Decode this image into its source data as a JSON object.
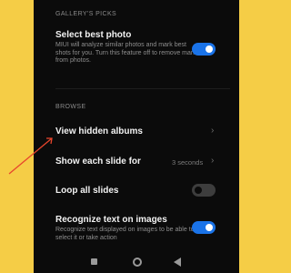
{
  "gallery_picks": {
    "header": "GALLERY'S PICKS",
    "select_best_photo": {
      "title": "Select best photo",
      "description": "MIUI will analyze similar photos and mark best shots for you. Turn this feature off to remove marks from photos.",
      "enabled": true
    }
  },
  "browse": {
    "header": "BROWSE",
    "view_hidden_albums": {
      "title": "View hidden albums"
    },
    "show_each_slide_for": {
      "title": "Show each slide for",
      "value": "3 seconds"
    },
    "loop_all_slides": {
      "title": "Loop all slides",
      "enabled": false
    },
    "recognize_text": {
      "title": "Recognize text on images",
      "description": "Recognize text displayed on images to be able to select it or take action",
      "enabled": true
    }
  },
  "colors": {
    "background": "#f5cd46",
    "accent_toggle": "#1a73e8",
    "annotation_arrow": "#e8452c"
  },
  "icons": {
    "chevron": "chevron-right-icon",
    "nav_recent": "square-icon",
    "nav_home": "circle-icon",
    "nav_back": "triangle-back-icon"
  }
}
